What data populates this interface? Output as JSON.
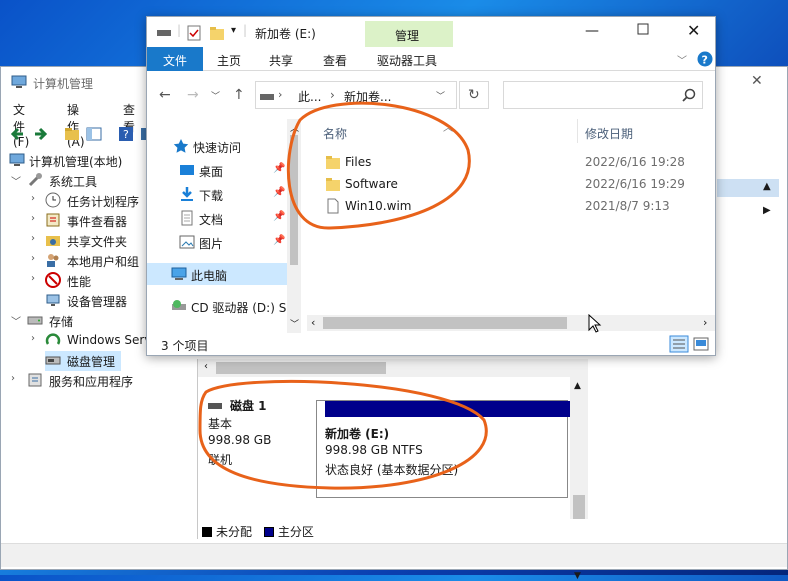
{
  "computer_management": {
    "title": "计算机管理",
    "close_glyph": "✕",
    "menu": [
      "文件(F)",
      "操作(A)",
      "查看"
    ],
    "tree": {
      "root": "计算机管理(本地)",
      "system_tools": "系统工具",
      "task_scheduler": "任务计划程序",
      "event_viewer": "事件查看器",
      "shared_folders": "共享文件夹",
      "local_users": "本地用户和组",
      "performance": "性能",
      "device_manager": "设备管理器",
      "storage": "存储",
      "windows_server": "Windows Serv",
      "disk_management": "磁盘管理",
      "services_apps": "服务和应用程序"
    },
    "disk": {
      "name": "磁盘 1",
      "type": "基本",
      "size": "998.98 GB",
      "status": "联机"
    },
    "volume": {
      "label": "新加卷 (E:)",
      "size_fs": "998.98 GB NTFS",
      "health": "状态良好 (基本数据分区)"
    },
    "legend": {
      "unallocated": "未分配",
      "primary": "主分区"
    },
    "colors": {
      "primary_partition": "#00008b",
      "unallocated": "#000000"
    }
  },
  "explorer": {
    "title": "新加卷 (E:)",
    "context_tab": "管理",
    "tabs": {
      "file": "文件",
      "home": "主页",
      "share": "共享",
      "view": "查看",
      "drive_tools": "驱动器工具"
    },
    "address": {
      "part1": "此...",
      "sep": "›",
      "part2": "新加卷..."
    },
    "nav": {
      "quick_access": "快速访问",
      "desktop": "桌面",
      "downloads": "下载",
      "documents": "文档",
      "pictures": "图片",
      "this_pc": "此电脑",
      "cd_drive": "CD 驱动器 (D:) S"
    },
    "columns": {
      "name": "名称",
      "date": "修改日期"
    },
    "files": [
      {
        "name": "Files",
        "date": "2022/6/16 19:28",
        "kind": "folder"
      },
      {
        "name": "Software",
        "date": "2022/6/16 19:29",
        "kind": "folder"
      },
      {
        "name": "Win10.wim",
        "date": "2021/8/7 9:13",
        "kind": "file"
      }
    ],
    "status": "3 个项目",
    "accent": "#1979ca"
  }
}
